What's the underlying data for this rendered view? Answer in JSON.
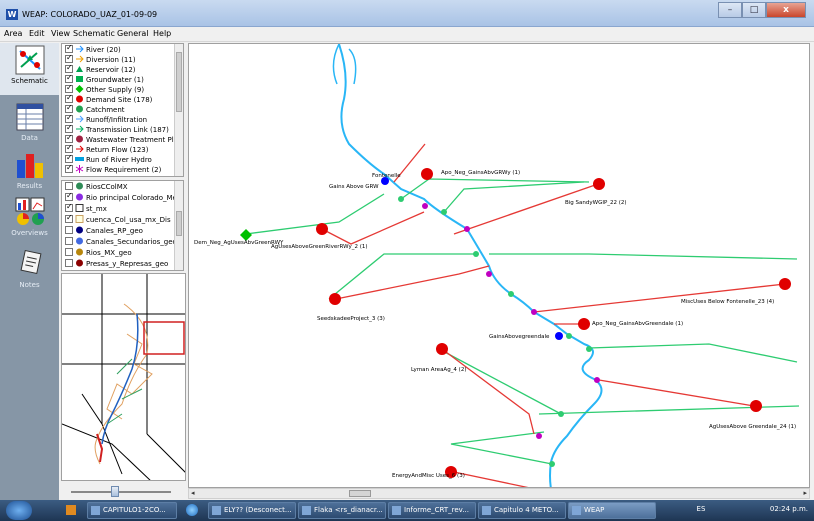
{
  "window": {
    "app_icon": "W",
    "title": "WEAP: COLORADO_UAZ_01-09-09",
    "buttons": {
      "minimize": "–",
      "maximize": "□",
      "close": "x"
    }
  },
  "menu": [
    "Area",
    "Edit",
    "View",
    "Schematic",
    "General",
    "Help"
  ],
  "view_bar": [
    {
      "label": "Schematic",
      "icon": "schematic-icon",
      "active": true
    },
    {
      "label": "Data",
      "icon": "data-icon",
      "active": false
    },
    {
      "label": "Results",
      "icon": "results-icon",
      "active": false
    },
    {
      "label": "Overviews",
      "icon": "overviews-icon",
      "active": false
    },
    {
      "label": "Notes",
      "icon": "notes-icon",
      "active": false
    }
  ],
  "legend_elements": [
    {
      "label": "River (20)",
      "symbol": "river-arrow",
      "color": "#1e90ff"
    },
    {
      "label": "Diversion (11)",
      "symbol": "diversion-arrow",
      "color": "#f0a000"
    },
    {
      "label": "Reservoir (12)",
      "symbol": "triangle",
      "color": "#00a050"
    },
    {
      "label": "Groundwater (1)",
      "symbol": "square",
      "color": "#00b050"
    },
    {
      "label": "Other Supply (9)",
      "symbol": "diamond",
      "color": "#00c000"
    },
    {
      "label": "Demand Site (178)",
      "symbol": "circle",
      "color": "#e00000"
    },
    {
      "label": "Catchment",
      "symbol": "circle",
      "color": "#20a050"
    },
    {
      "label": "Runoff/Infiltration",
      "symbol": "runoff-arrow",
      "color": "#4aa0ff"
    },
    {
      "label": "Transmission Link (187)",
      "symbol": "link-arrow",
      "color": "#00b060"
    },
    {
      "label": "Wastewater Treatment Plant",
      "symbol": "circle",
      "color": "#a02040"
    },
    {
      "label": "Return Flow (123)",
      "symbol": "return-arrow",
      "color": "#e00000"
    },
    {
      "label": "Run of River Hydro",
      "symbol": "bar",
      "color": "#00a0e0"
    },
    {
      "label": "Flow Requirement (2)",
      "symbol": "asterisk",
      "color": "#c000c0"
    }
  ],
  "legend_layers": [
    {
      "label": "RiosCColMX",
      "checked": false,
      "color": "#2e8b57"
    },
    {
      "label": "Rio principal Colorado_Mex",
      "checked": true,
      "color": "#8a2be2"
    },
    {
      "label": "st_mx",
      "checked": true,
      "color": "#ffffff"
    },
    {
      "label": "cuenca_Col_usa_mx_Dis",
      "checked": true,
      "color": "#ffffe0"
    },
    {
      "label": "Canales_RP_geo",
      "checked": false,
      "color": "#000080"
    },
    {
      "label": "Canales_Secundarios_geo",
      "checked": false,
      "color": "#4169e1"
    },
    {
      "label": "Rios_MX_geo",
      "checked": false,
      "color": "#b8860b"
    },
    {
      "label": "Presas_y_Represas_geo",
      "checked": false,
      "color": "#8b0000"
    }
  ],
  "schematic": {
    "labels": {
      "fontenelle": "Fontenelle",
      "gains_above_grw": "Gains Above GRW",
      "apo_neg_gains": "Apo_Neg_GainsAbvGRWy (1)",
      "big_sandy": "Big SandyWGIP_22 (2)",
      "dem_neg": "Dem_Neg_AgUsesAbvGreenRWY",
      "ag_uses_green": "AgUsesAboveGreenRiverRWy_2 (1)",
      "seedskadee": "SeedskadeeProject_3 (3)",
      "misc_below_fontenelle": "MiscUses Below Fontenelle_23 (4)",
      "gains_above_greendale": "GainsAbovegreendale",
      "apo_neg_greendale": "Apo_Neg_GainsAbvGreendale (1)",
      "lyman": "Lyman AreaAg_4 (2)",
      "ag_above_greendale": "AgUsesAbove Greendale_24 (1)",
      "energy": "EnergyAndMisc Uses_6 (3)"
    }
  },
  "taskbar": {
    "apps": [
      {
        "label": "CAPITULO1-2CO...",
        "active": false
      },
      {
        "label": "ELY?? (Desconect...",
        "active": false
      },
      {
        "label": "Flaka <rs_dianacr...",
        "active": false
      },
      {
        "label": "Informe_CRT_rev...",
        "active": false
      },
      {
        "label": "Capitulo 4 METO...",
        "active": false
      },
      {
        "label": "WEAP",
        "active": true
      }
    ],
    "language": "ES",
    "clock": "02:24 p.m."
  }
}
